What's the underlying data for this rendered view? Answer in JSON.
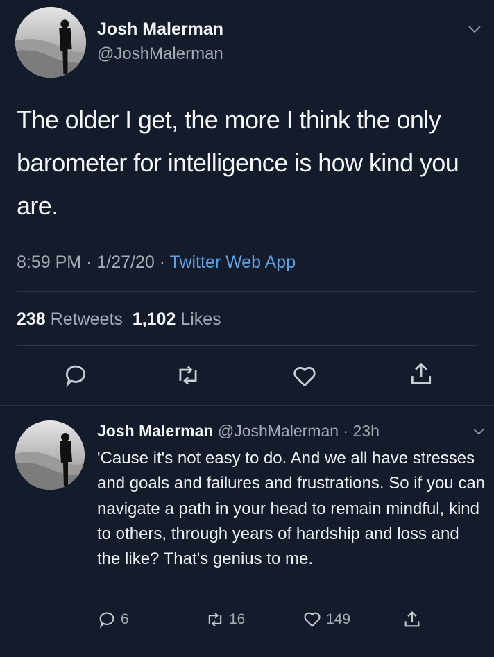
{
  "main_tweet": {
    "author": {
      "name": "Josh Malerman",
      "handle": "@JoshMalerman"
    },
    "text": "The older I get, the more I think the only barometer for intelligence is how kind you are.",
    "time": "8:59 PM",
    "date": "1/27/20",
    "separator": "·",
    "source": "Twitter Web App",
    "retweets_count": "238",
    "retweets_label": "Retweets",
    "likes_count": "1,102",
    "likes_label": "Likes"
  },
  "reply_tweet": {
    "author": {
      "name": "Josh Malerman",
      "handle": "@JoshMalerman"
    },
    "age": "23h",
    "separator": "·",
    "text": "'Cause it's not easy to do. And we all have stresses and goals and failures and frustrations. So if you can navigate a path in your head to remain mindful, kind to others, through years of hardship and loss and the like? That's genius to me.",
    "reply_count": "6",
    "retweet_count": "16",
    "like_count": "149"
  },
  "icons": {
    "reply": "speech-bubble-icon",
    "retweet": "retweet-arrows-icon",
    "like": "heart-icon",
    "share": "share-upload-icon",
    "more": "chevron-down-icon"
  },
  "colors": {
    "background": "#141b2a",
    "text_primary": "#f2f4f6",
    "text_secondary": "#a3acb6",
    "link": "#5aa3e6",
    "divider": "#2f3847"
  }
}
